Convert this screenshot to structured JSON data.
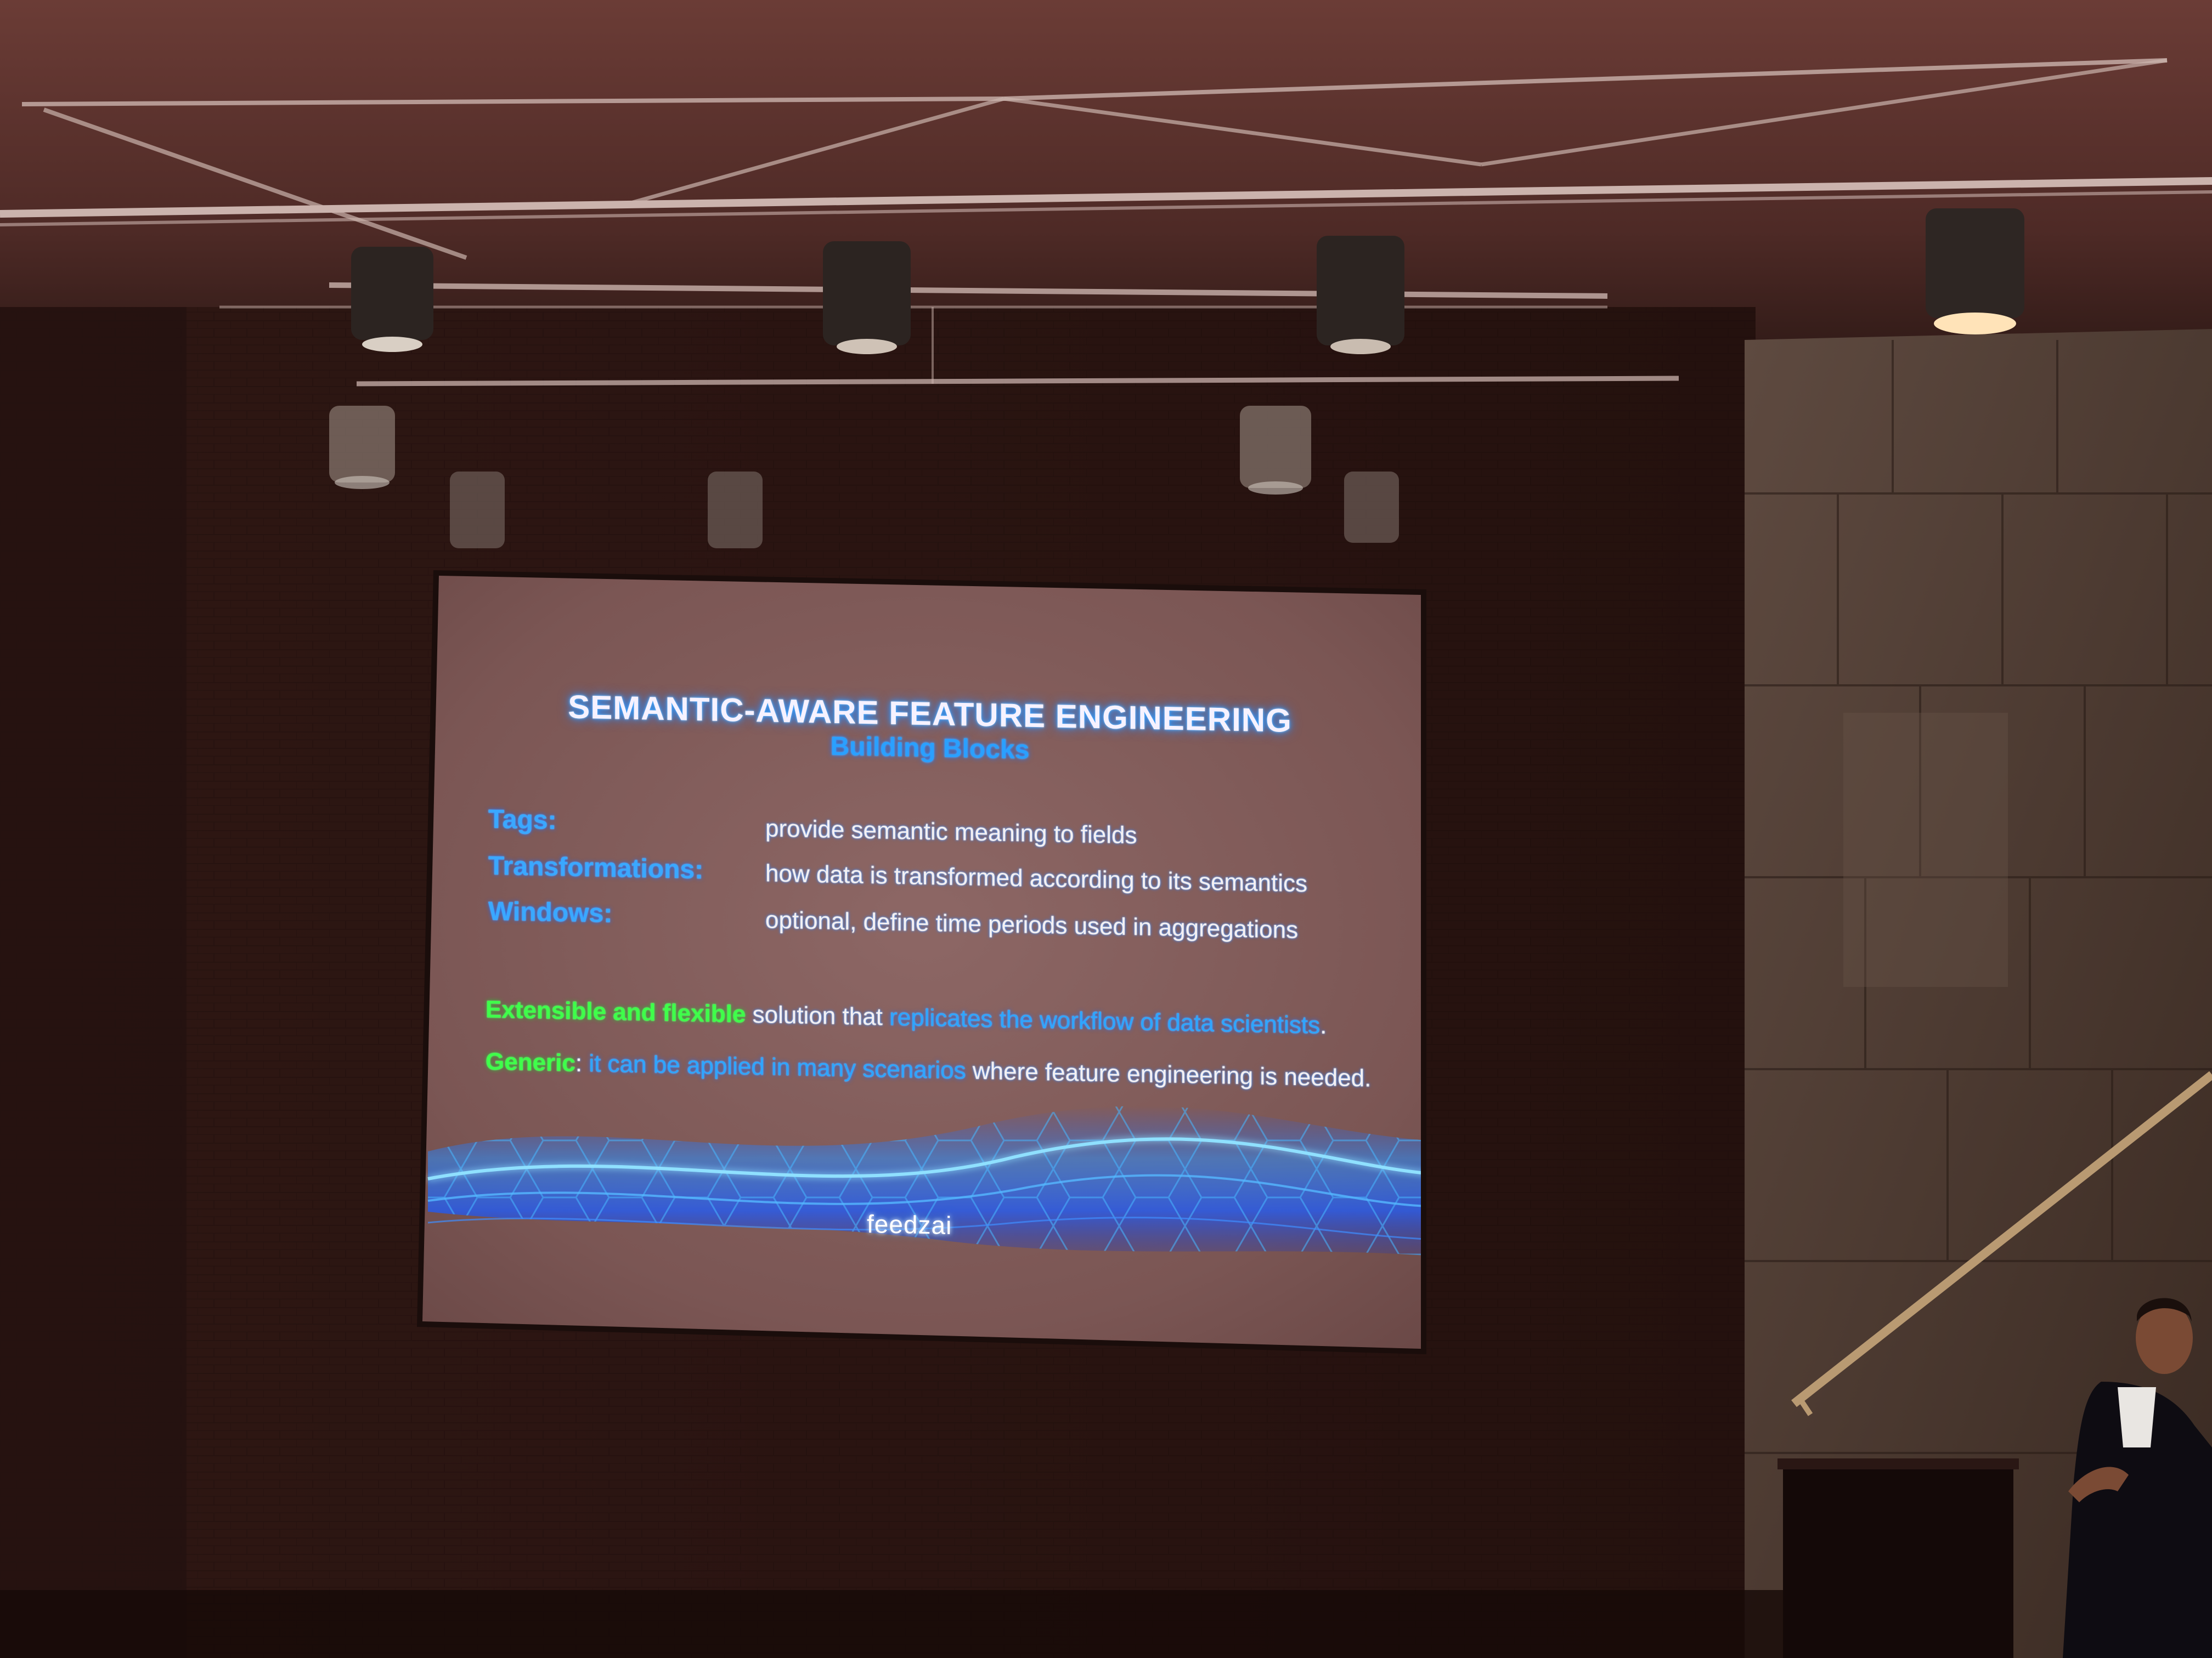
{
  "slide": {
    "title": "SEMANTIC-AWARE FEATURE ENGINEERING",
    "subtitle": "Building Blocks",
    "blocks": [
      {
        "term": "Tags:",
        "description": "provide semantic meaning to fields"
      },
      {
        "term": "Transformations:",
        "description": "how data is transformed according to its semantics"
      },
      {
        "term": "Windows:",
        "description": "optional, define time periods used in aggregations"
      }
    ],
    "statements": [
      {
        "highlight": "Extensible and flexible",
        "middle": " solution that ",
        "emphasis": "replicates the workflow of data scientists",
        "end": "."
      },
      {
        "highlight": "Generic",
        "middle": ": ",
        "emphasis": "it can be applied in many scenarios",
        "end": " where feature engineering is needed."
      }
    ],
    "logo": "feedzai"
  },
  "colors": {
    "accent_blue": "#2ea6ff",
    "accent_green": "#3fff4a",
    "screen_background": "#8a6462"
  }
}
